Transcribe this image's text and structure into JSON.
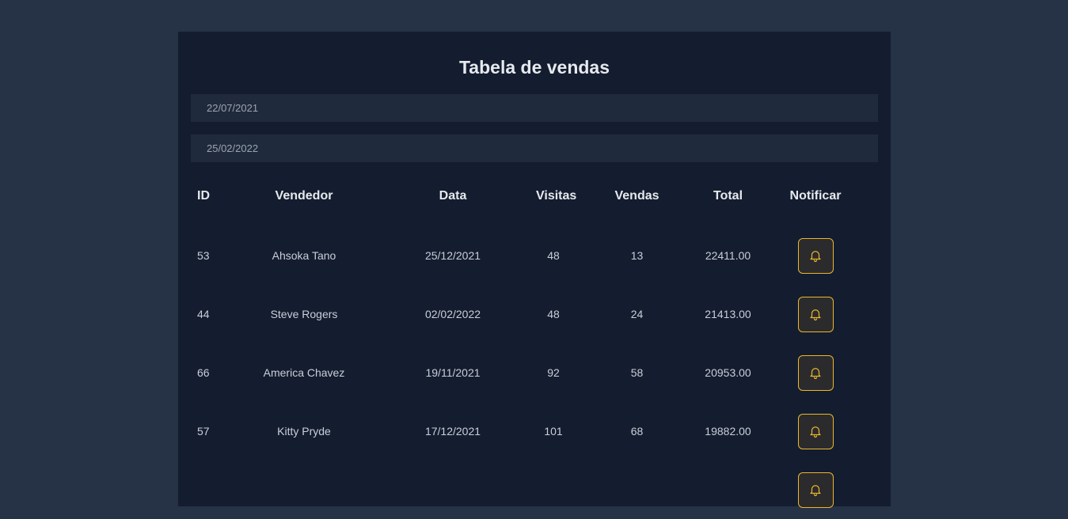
{
  "page": {
    "title": "Tabela de vendas"
  },
  "filters": {
    "min_date": "22/07/2021",
    "max_date": "25/02/2022"
  },
  "table": {
    "headers": [
      "ID",
      "Vendedor",
      "Data",
      "Visitas",
      "Vendas",
      "Total",
      "Notificar"
    ],
    "rows": [
      {
        "id": "53",
        "seller": "Ahsoka Tano",
        "date": "25/12/2021",
        "visits": "48",
        "sales": "13",
        "total": "22411.00",
        "notify_icon": "bell-icon"
      },
      {
        "id": "44",
        "seller": "Steve Rogers",
        "date": "02/02/2022",
        "visits": "48",
        "sales": "24",
        "total": "21413.00",
        "notify_icon": "bell-icon"
      },
      {
        "id": "66",
        "seller": "America Chavez",
        "date": "19/11/2021",
        "visits": "92",
        "sales": "58",
        "total": "20953.00",
        "notify_icon": "bell-icon"
      },
      {
        "id": "57",
        "seller": "Kitty Pryde",
        "date": "17/12/2021",
        "visits": "101",
        "sales": "68",
        "total": "19882.00",
        "notify_icon": "bell-icon"
      },
      {
        "id": "",
        "seller": "",
        "date": "",
        "visits": "",
        "sales": "",
        "total": "",
        "notify_icon": "bell-icon"
      }
    ]
  },
  "colors": {
    "page_background": "#263246",
    "card_background": "#141d2f",
    "input_background": "#1f2a3c",
    "accent": "#ecb62a"
  }
}
